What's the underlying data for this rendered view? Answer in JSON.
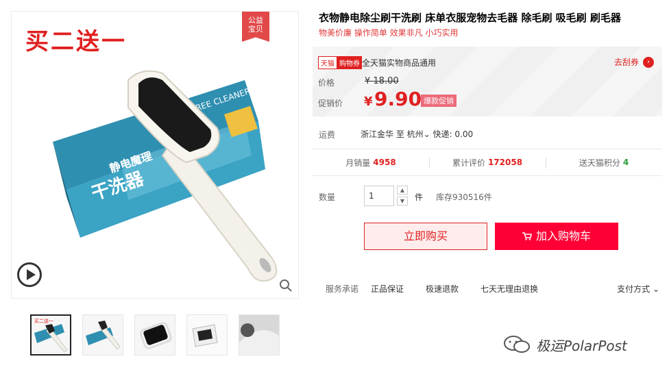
{
  "main_image": {
    "promo_text": "买二送一",
    "charity_badge": [
      "公益",
      "宝贝"
    ],
    "packaging_text": [
      "静电魔理",
      "干洗器",
      "REE CLEANER"
    ]
  },
  "thumbnails": [
    {
      "label": "thumbnail-1",
      "active": true
    },
    {
      "label": "thumbnail-2",
      "active": false
    },
    {
      "label": "thumbnail-3",
      "active": false
    },
    {
      "label": "thumbnail-4",
      "active": false
    },
    {
      "label": "thumbnail-5",
      "active": false
    }
  ],
  "product": {
    "title": "衣物静电除尘刷干洗刷 床单衣服宠物去毛器 除毛刷 吸毛刷 刷毛器",
    "subtitle": "物美价廉 操作简单 效果非凡 小巧实用"
  },
  "price_box": {
    "coupon_tag_left": "天猫",
    "coupon_tag_right": "购物券",
    "coupon_text": "全天猫实物商品通用",
    "get_coupon": "去刮券",
    "price_label": "价格",
    "original_price": "¥ 18.00",
    "promo_label": "促销价",
    "currency": "¥",
    "sale_price": "9.90",
    "sale_tag": "爆款促销"
  },
  "shipping": {
    "label": "运费",
    "value": "浙江金华 至 杭州",
    "express": "快递: 0.00"
  },
  "stats": [
    {
      "label": "月销量",
      "value": "4958",
      "color": "#e02020"
    },
    {
      "label": "累计评价",
      "value": "172058",
      "color": "#e02020"
    },
    {
      "label": "送天猫积分",
      "value": "4",
      "color": "#2a9d3a"
    }
  ],
  "quantity": {
    "label": "数量",
    "value": "1",
    "unit": "件",
    "stock": "库存930516件"
  },
  "buttons": {
    "buy_now": "立即购买",
    "add_cart": "加入购物车"
  },
  "services": {
    "label": "服务承诺",
    "items": [
      "正品保证",
      "极速退款",
      "七天无理由退换"
    ],
    "payment": "支付方式"
  },
  "watermark": "极运PolarPost",
  "colors": {
    "accent": "#e02020",
    "cart": "#ff0036",
    "green": "#2a9d3a"
  }
}
